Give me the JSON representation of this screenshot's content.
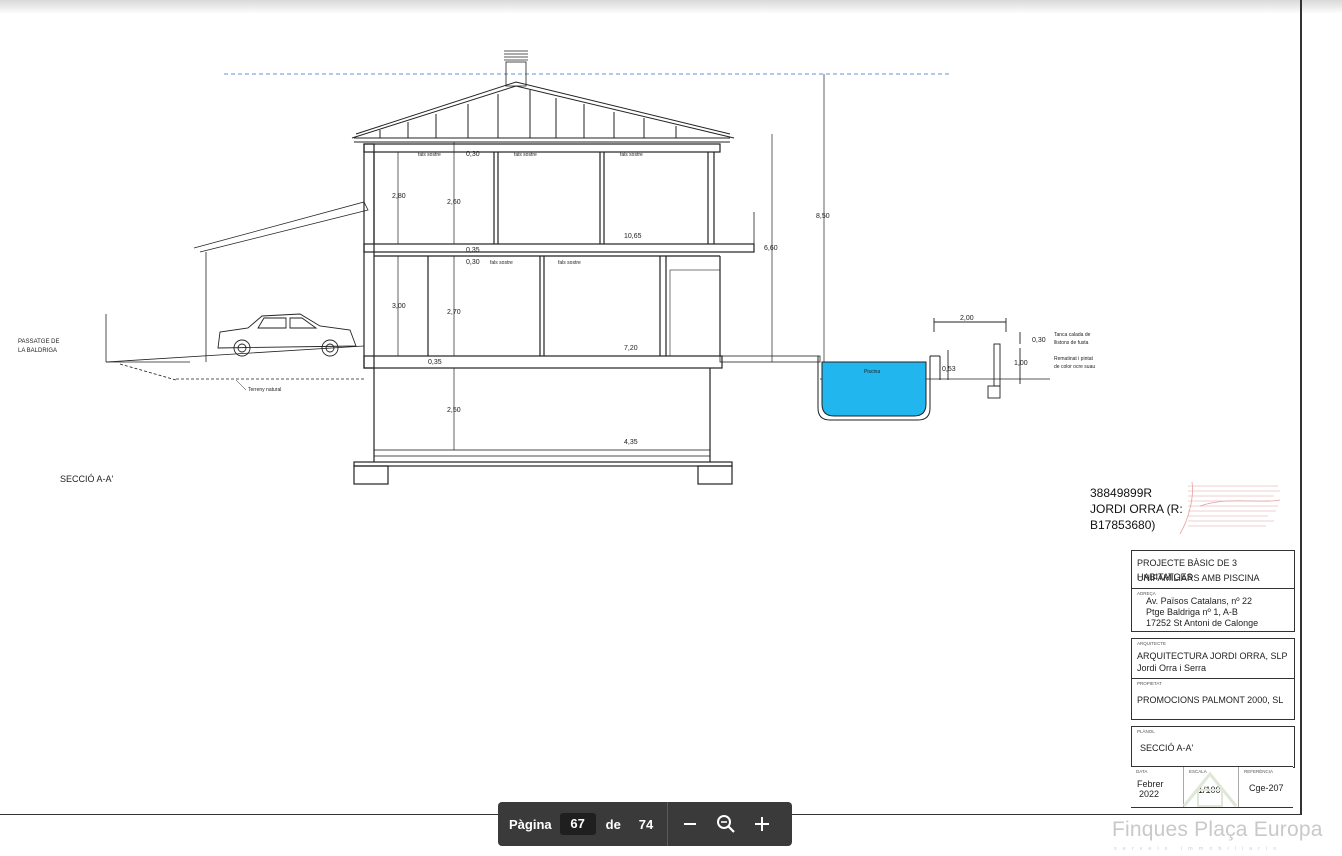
{
  "drawing": {
    "section_label": "SECCIÓ A-A'",
    "passage_label_1": "PASSATGE DE",
    "passage_label_2": "LA BALDRIGA",
    "terrain_label": "Terreny natural",
    "pool_label": "Piscina",
    "fence_note_1": "Tanca calada de",
    "fence_note_2": "llistons de fusta",
    "finish_note_1": "Rematinat i pintat",
    "finish_note_2": "de color ocre suau",
    "ceiling_label": "fals sostre",
    "dims": {
      "top_floor_height": "2,80",
      "top_clear_height": "2,60",
      "top_slab": "0,30",
      "mid_slab": "0,35",
      "mid_slab_b": "0,30",
      "mid_floor_height": "3,00",
      "mid_clear_height": "2,70",
      "ground_slab": "0,35",
      "basement_height": "2,50",
      "level_top": "10,65",
      "level_mid": "7,20",
      "level_base": "4,35",
      "total_height": "8,50",
      "upper_height": "6,60",
      "fence_width": "2,00",
      "fence_cap": "0,30",
      "fence_height": "1,00",
      "pool_edge": "0,53"
    }
  },
  "signature": {
    "line1": "38849899R",
    "line2": "JORDI ORRA (R:",
    "line3": "B17853680)"
  },
  "titleblock": {
    "project_line1": "PROJECTE BÀSIC DE 3 HABITATGES",
    "project_line2": "UNIFAMILIARS  AMB PISCINA",
    "address_label": "ADREÇA",
    "address_line1": "Av. Països Catalans, nº 22",
    "address_line2": "Ptge Baldriga nº 1, A-B",
    "address_line3": "17252 St Antoni de Calonge",
    "architect_label": "ARQUITECTE",
    "architect_line1": "ARQUITECTURA JORDI ORRA, SLP",
    "architect_line2": "Jordi Orra i Serra",
    "owner_label": "PROPIETAT",
    "owner_line1": "PROMOCIONS PALMONT 2000, SL",
    "plan_label": "PLÀNOL",
    "plan_name": "SECCIÓ A-A'",
    "date_label": "DATA",
    "date_value_1": "Febrer",
    "date_value_2": "2022",
    "scale_label": "ESCALA",
    "scale_value": "1/100",
    "ref_label": "REFERÈNCIA",
    "ref_value": "Cge-207"
  },
  "watermark": {
    "brand": "Finques Plaça Europa",
    "tagline": "serveis immobiliaris"
  },
  "toolbar": {
    "page_label": "Pàgina",
    "current_page": "67",
    "of_label": "de",
    "total_pages": "74",
    "zoom_out_icon": "minus-icon",
    "zoom_icon": "magnifier-icon",
    "zoom_in_icon": "plus-icon"
  },
  "colors": {
    "pool_water": "#21b7ee",
    "toolbar_bg": "#3a3a3a",
    "dashed_guide": "#3a6fd0"
  }
}
